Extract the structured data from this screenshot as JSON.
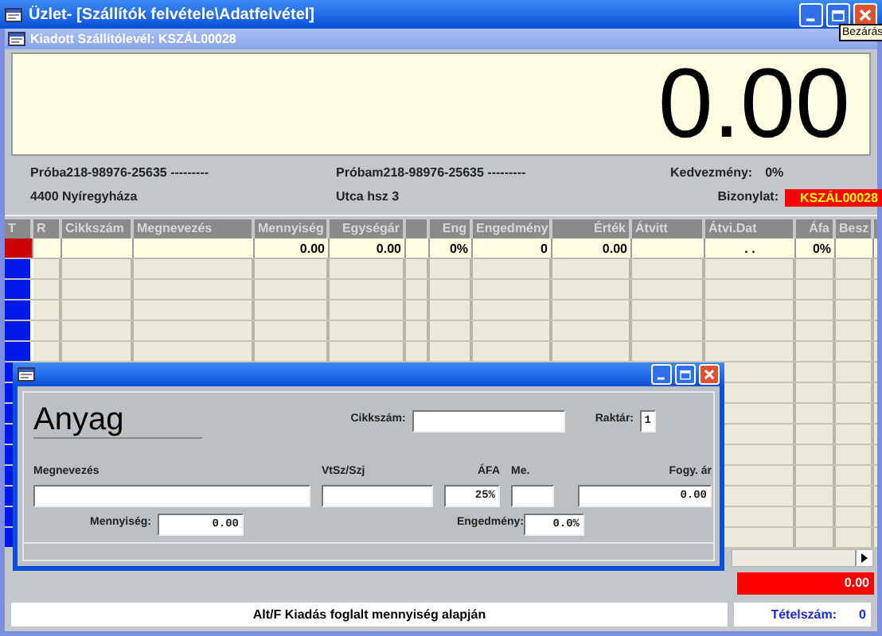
{
  "window": {
    "title": "Üzlet-  [Szállítók felvétele\\Adatfelvétel]"
  },
  "tooltip": "Bezárás",
  "document_window": {
    "title": "Kiadott Szállítólevél:  KSZÁL00028"
  },
  "display": "0.00",
  "info": {
    "partner": "Próba218-98976-25635 ---------",
    "city": "4400 Nyíregyháza",
    "partner_2": "Próbam218-98976-25635 ---------",
    "street": "Utca hsz 3",
    "discount_label": "Kedvezmény:",
    "discount": "0%",
    "document_label": "Bizonylat:",
    "document": "KSZÁL00028"
  },
  "table": {
    "columns": [
      "T",
      "R",
      "Cikkszám",
      "Megnevezés",
      "Mennyiség",
      "Egységár",
      "Eng",
      "Engedmény",
      "Érték",
      "Átvitt",
      "Átvi.Dat",
      "Áfa",
      "Besz"
    ],
    "rows": [
      {
        "selected": true,
        "cells": [
          null,
          null,
          null,
          null,
          "0.00",
          "0.00",
          "0%",
          "0",
          "0.00",
          null,
          ". .",
          "0%",
          null
        ]
      }
    ]
  },
  "dialog": {
    "heading": "Anyag",
    "item_code_label": "Cikkszám:",
    "warehouse_label": "Raktár:",
    "warehouse": "1",
    "name_label": "Megnevezés",
    "vtsz_label": "VtSz/Szj",
    "vat_label": "ÁFA",
    "vat": "25%",
    "unit_label": "Me.",
    "price_label": "Fogy. ár",
    "price": "0.00",
    "quantity_label": "Mennyiség:",
    "quantity": "0.00",
    "discount_label": "Engedmény:",
    "discount": "0.0%"
  },
  "total": "0.00",
  "status": {
    "hint": "Alt/F Kiadás foglalt mennyiség alapján",
    "count_label": "Tételszám:",
    "count": "0"
  }
}
